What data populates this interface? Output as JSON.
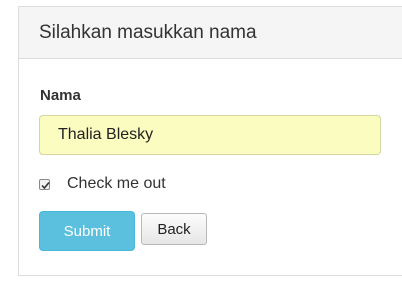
{
  "panel": {
    "heading": "Silahkan masukkan nama"
  },
  "form": {
    "name_label": "Nama",
    "name_value": "Thalia Blesky",
    "checkbox_label": "Check me out",
    "checkbox_checked": true,
    "submit_label": "Submit",
    "back_label": "Back"
  },
  "colors": {
    "input_background": "#fbfcbf",
    "submit_background": "#5bc0de",
    "heading_background": "#f5f5f5"
  },
  "icons": {
    "checkbox_mark": "checkmark-icon"
  }
}
